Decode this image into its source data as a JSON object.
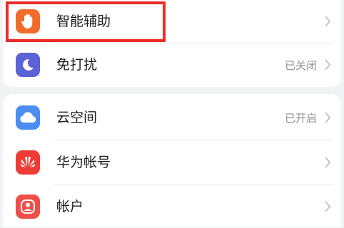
{
  "settings": {
    "items": [
      {
        "label": "智能辅助",
        "value": "",
        "icon": "hand-icon",
        "color": "#f26b2b"
      },
      {
        "label": "免打扰",
        "value": "已关闭",
        "icon": "moon-icon",
        "color": "#5b63d6"
      },
      {
        "label": "云空间",
        "value": "已开启",
        "icon": "cloud-icon",
        "color": "#4a8ef2"
      },
      {
        "label": "华为帐号",
        "value": "",
        "icon": "huawei-logo-icon",
        "color": "#ef3b36"
      },
      {
        "label": "帐户",
        "value": "",
        "icon": "account-icon",
        "color": "#ef4f4a"
      }
    ]
  },
  "highlight_color": "#ee2b2b"
}
